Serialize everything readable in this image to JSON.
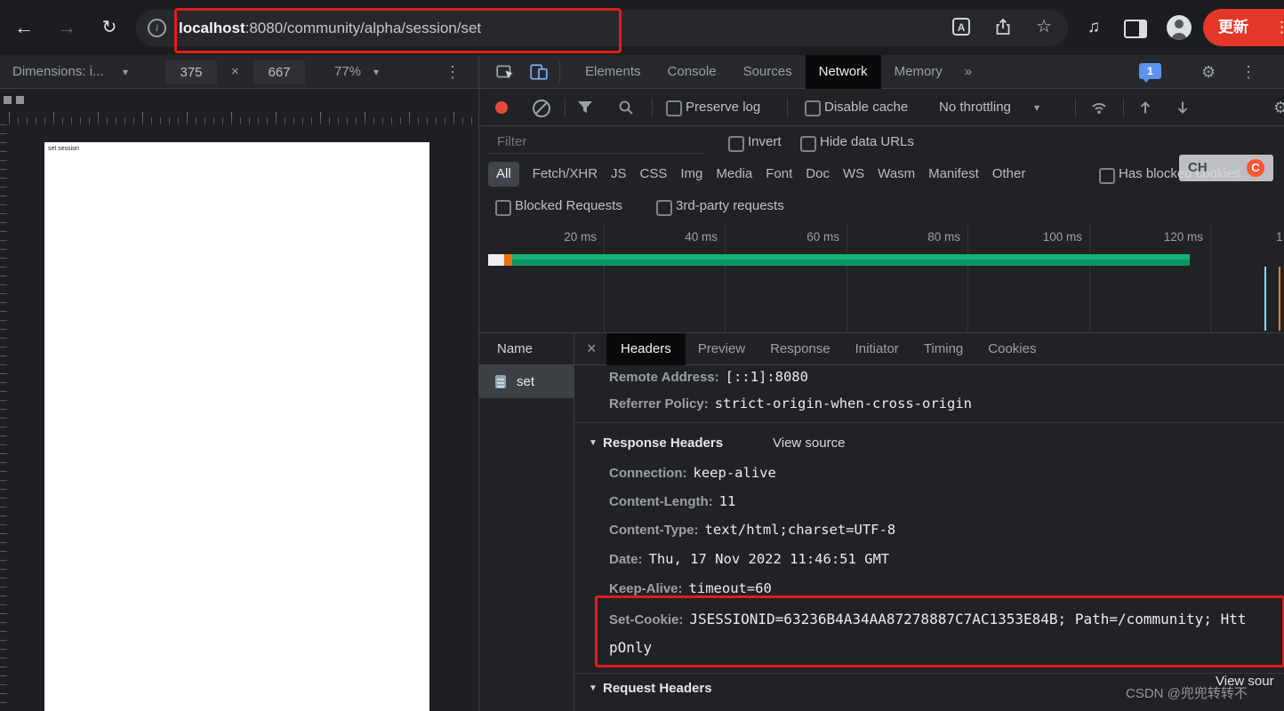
{
  "browser": {
    "url": {
      "host": "localhost",
      "path": ":8080/community/alpha/session/set"
    },
    "update_button": "更新"
  },
  "device_toolbar": {
    "dimensions": "Dimensions: i...",
    "width": "375",
    "height": "667",
    "zoom": "77%"
  },
  "preview": {
    "page_text": "set session"
  },
  "devtools": {
    "tabs": {
      "items": [
        "Elements",
        "Console",
        "Sources",
        "Network",
        "Memory"
      ],
      "selected": "Network",
      "issues_count": "1"
    },
    "network": {
      "toolbar": {
        "preserve_log": "Preserve log",
        "disable_cache": "Disable cache",
        "throttling": "No throttling"
      },
      "filter_bar": {
        "placeholder": "Filter",
        "invert": "Invert",
        "hide_data_urls": "Hide data URLs"
      },
      "type_filters": [
        "All",
        "Fetch/XHR",
        "JS",
        "CSS",
        "Img",
        "Media",
        "Font",
        "Doc",
        "WS",
        "Wasm",
        "Manifest",
        "Other"
      ],
      "selected_type": "All",
      "has_blocked_cookies": "Has blocked cookies",
      "blocked_requests": "Blocked Requests",
      "third_party_requests": "3rd-party requests",
      "overview": {
        "ticks": [
          "20 ms",
          "40 ms",
          "60 ms",
          "80 ms",
          "100 ms",
          "120 ms"
        ],
        "partial_tick": "1"
      },
      "requests": {
        "name_header": "Name",
        "selected": "set"
      },
      "detail_tabs": [
        "Headers",
        "Preview",
        "Response",
        "Initiator",
        "Timing",
        "Cookies"
      ],
      "selected_detail_tab": "Headers",
      "headers_panel": {
        "general": [
          {
            "name": "Remote Address:",
            "value": "[::1]:8080"
          },
          {
            "name": "Referrer Policy:",
            "value": "strict-origin-when-cross-origin"
          }
        ],
        "response_headers_title": "Response Headers",
        "view_source": "View source",
        "response_headers": [
          {
            "name": "Connection:",
            "value": "keep-alive"
          },
          {
            "name": "Content-Length:",
            "value": "11"
          },
          {
            "name": "Content-Type:",
            "value": "text/html;charset=UTF-8"
          },
          {
            "name": "Date:",
            "value": "Thu, 17 Nov 2022 11:46:51 GMT"
          },
          {
            "name": "Keep-Alive:",
            "value": "timeout=60"
          },
          {
            "name": "Set-Cookie:",
            "value": "JSESSIONID=63236B4A34AA87278887C7AC1353E84B; Path=/community; HttpOnly"
          }
        ],
        "request_headers_title": "Request Headers",
        "view_source_clipped": "View sour"
      }
    }
  },
  "overlays": {
    "screenshot_badge": "CH",
    "csdn_logo": "C",
    "watermark": "CSDN @兜兜转转不"
  },
  "icons": {
    "back": "←",
    "forward": "→",
    "reload": "↻",
    "info": "i",
    "star": "☆",
    "media_controls": "♫",
    "more_vertical": "⋮",
    "tab_overflow": "»",
    "settings_gear": "⚙",
    "close": "×",
    "caret_down": "▾",
    "disclosure": "▼",
    "multiply": "×"
  },
  "colors": {
    "accent_blue": "#7cacf8",
    "highlight_red": "#e01c1c",
    "overview_green": "#0fa36b",
    "overview_orange": "#e8710a",
    "record_red": "#e8493d",
    "update_button_red": "#e5362a"
  }
}
